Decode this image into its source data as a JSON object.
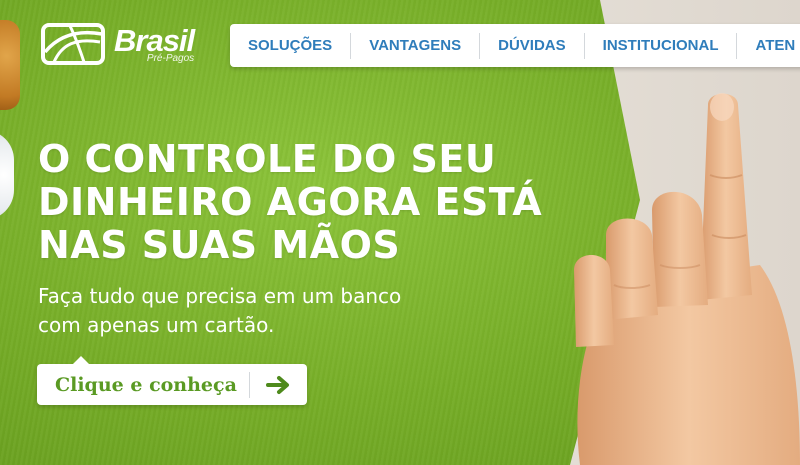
{
  "brand": {
    "name": "Brasil",
    "subtitle": "Pré-Pagos"
  },
  "nav": {
    "items": [
      {
        "label": "SOLUÇÕES"
      },
      {
        "label": "VANTAGENS"
      },
      {
        "label": "DÚVIDAS"
      },
      {
        "label": "INSTITUCIONAL"
      },
      {
        "label": "ATEN"
      }
    ]
  },
  "hero": {
    "headline": [
      "O CONTROLE DO SEU",
      "DINHEIRO AGORA ESTÁ",
      "NAS SUAS MÃOS"
    ],
    "subline": [
      "Faça tudo que precisa em um banco",
      "com apenas um cartão."
    ],
    "cta_label": "Clique e conheça"
  },
  "colors": {
    "green": "#78b02a",
    "nav_text": "#2f7dbb",
    "cta_text": "#5a9a23"
  },
  "icons": {
    "logo": "card-logo-icon",
    "cta": "arrow-right-icon"
  }
}
